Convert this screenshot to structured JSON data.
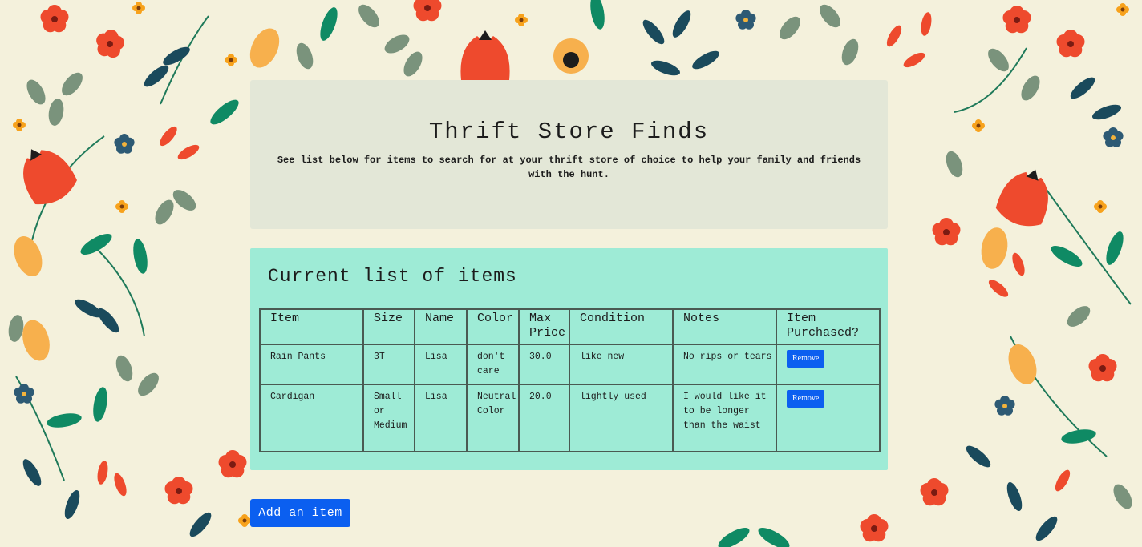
{
  "header": {
    "title": "Thrift Store Finds",
    "subtitle": "See list below for items to search for at your thrift store of choice to help your family and friends with the hunt."
  },
  "list": {
    "title": "Current list of items",
    "columns": [
      "Item",
      "Size",
      "Name",
      "Color",
      "Max Price",
      "Condition",
      "Notes",
      "Item Purchased?"
    ],
    "rows": [
      {
        "item": "Rain Pants",
        "size": "3T",
        "name": "Lisa",
        "color": "don't care",
        "max_price": "30.0",
        "condition": "like new",
        "notes": "No rips or tears",
        "action": "Remove"
      },
      {
        "item": "Cardigan",
        "size": "Small or Medium",
        "name": "Lisa",
        "color": "Neutral Color",
        "max_price": "20.0",
        "condition": "lightly used",
        "notes": "I would like it to be longer than the waist",
        "action": "Remove"
      }
    ]
  },
  "add_button": "Add an item",
  "colors": {
    "background": "#f4f1dc",
    "header_box": "#e3e7d7",
    "list_box": "#9eebd6",
    "button": "#0b5ff0",
    "flower_red": "#ee4a2d",
    "flower_orange": "#f7b04d",
    "leaf_sage": "#7a937c",
    "leaf_navy": "#1a4a5c",
    "leaf_green": "#0f8a64"
  }
}
